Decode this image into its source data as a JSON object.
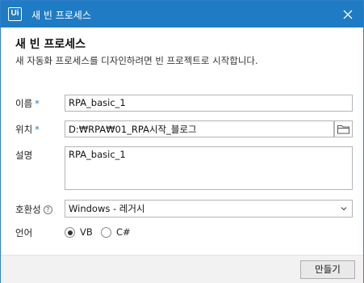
{
  "window": {
    "app_logo": "Ui",
    "title": "새 빈 프로세스"
  },
  "dialog": {
    "heading": "새 빈 프로세스",
    "subheading": "새 자동화 프로세스를 디자인하려면 빈 프로젝트로 시작합니다."
  },
  "form": {
    "name": {
      "label": "이름",
      "required_marker": "*",
      "value": "RPA_basic_1"
    },
    "location": {
      "label": "위치",
      "required_marker": "*",
      "value": "D:₩RPA₩01_RPA시작_블로그"
    },
    "description": {
      "label": "설명",
      "value": "RPA_basic_1"
    },
    "compatibility": {
      "label": "호환성",
      "help_icon": "?",
      "value": "Windows - 레거시"
    },
    "language": {
      "label": "언어",
      "options": [
        {
          "label": "VB",
          "selected": true
        },
        {
          "label": "C#",
          "selected": false
        }
      ]
    }
  },
  "footer": {
    "create_label": "만들기"
  },
  "colors": {
    "titlebar": "#1f7bc4",
    "required": "#1f7bc4",
    "footer": "#f2f2f2"
  }
}
